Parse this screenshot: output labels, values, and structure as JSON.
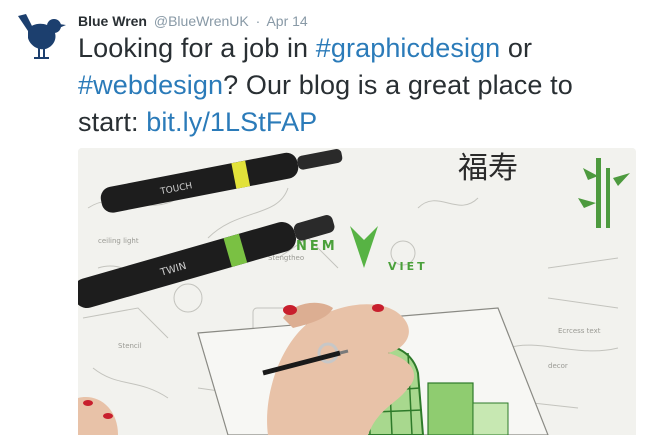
{
  "tweet": {
    "author_name": "Blue Wren",
    "author_handle": "@BlueWrenUK",
    "separator": "·",
    "date": "Apr 14",
    "text_parts": {
      "t1": "Looking for a job in ",
      "h1": "#graphicdesign",
      "t2": " or",
      "h2": "#webdesign",
      "t3": "? Our blog is a great place to",
      "t4": "start: ",
      "link": "bit.ly/1LStFAP"
    },
    "colors": {
      "link": "#2b7bb9",
      "text": "#292f33",
      "muted": "#8899a6",
      "logo": "#1c3f6e"
    },
    "avatar_icon": "wren-bird-logo",
    "media": {
      "marker1_text": "TOUCH",
      "marker2_text": "TWIN",
      "sketch_brand_left": "NEM",
      "sketch_brand_right": "VIET",
      "chinese_text": "福寿"
    }
  }
}
